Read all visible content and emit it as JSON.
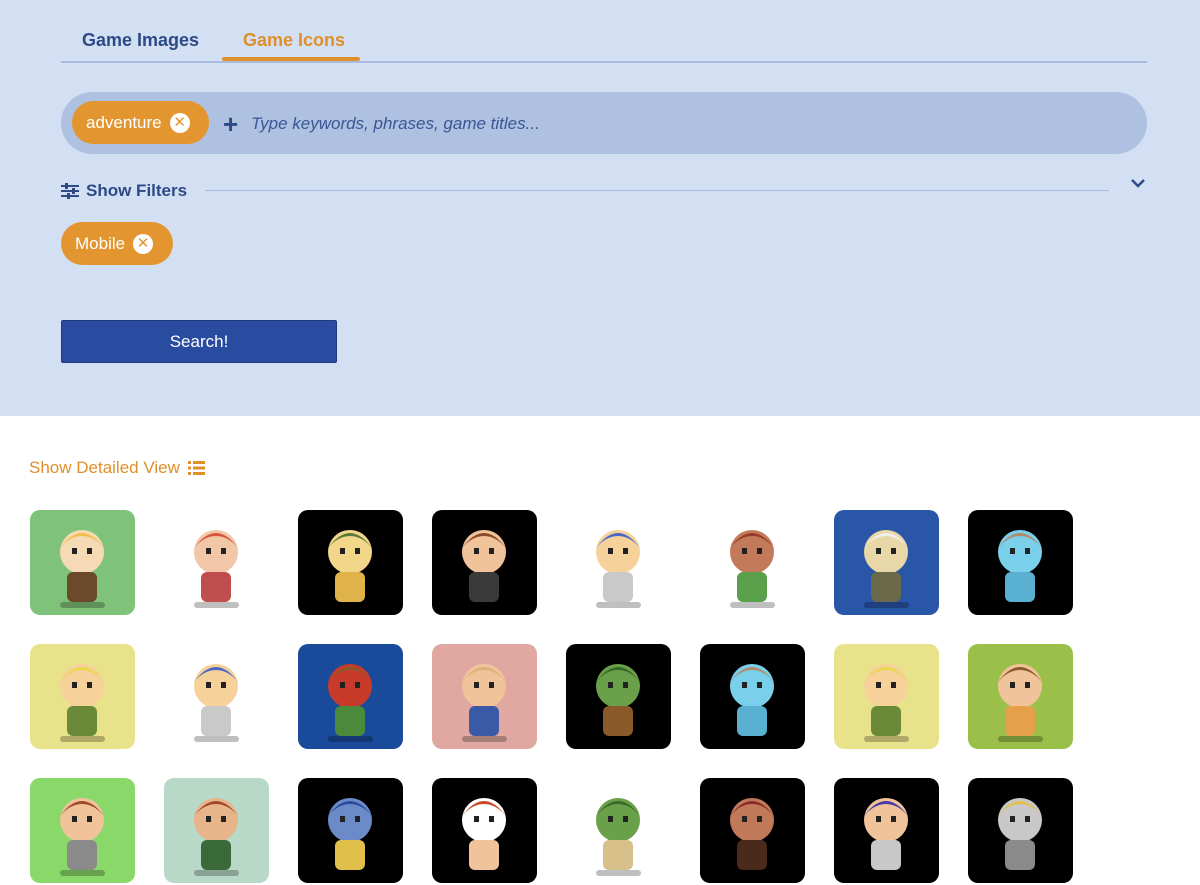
{
  "tabs": [
    {
      "label": "Game Images",
      "active": false
    },
    {
      "label": "Game Icons",
      "active": true
    }
  ],
  "search": {
    "chips": [
      "adventure"
    ],
    "placeholder": "Type keywords, phrases, game titles..."
  },
  "filters": {
    "label": "Show Filters",
    "chips": [
      "Mobile"
    ]
  },
  "search_button": "Search!",
  "detailed_view_label": "Show Detailed View",
  "colors": {
    "accent": "#e08f2b",
    "primary": "#2a4ca0",
    "panel": "#d3e0f4"
  },
  "results": [
    {
      "icon": "miner-pickaxe-icon"
    },
    {
      "icon": "pixel-heroine-icon"
    },
    {
      "icon": "archer-girl-icon"
    },
    {
      "icon": "pixel-boy-icon"
    },
    {
      "icon": "pixel-knight-icon"
    },
    {
      "icon": "runner-warrior-icon"
    },
    {
      "icon": "straw-hat-samurai-icon"
    },
    {
      "icon": "blue-ghost-icon"
    },
    {
      "icon": "blonde-girl-icon"
    },
    {
      "icon": "pixel-knight-icon"
    },
    {
      "icon": "red-hair-miner-icon"
    },
    {
      "icon": "cowboy-farmer-icon"
    },
    {
      "icon": "elf-archer-icon"
    },
    {
      "icon": "blue-ghost-icon"
    },
    {
      "icon": "blonde-girl-icon"
    },
    {
      "icon": "brown-hair-boy-icon"
    },
    {
      "icon": "red-hair-knight-icon"
    },
    {
      "icon": "miner-dwarf-icon"
    },
    {
      "icon": "blue-wizard-icon"
    },
    {
      "icon": "red-hair-girl-icon"
    },
    {
      "icon": "green-goblin-icon"
    },
    {
      "icon": "pixel-boy-icon"
    },
    {
      "icon": "purple-warrior-icon"
    },
    {
      "icon": "armored-knight-icon"
    }
  ]
}
